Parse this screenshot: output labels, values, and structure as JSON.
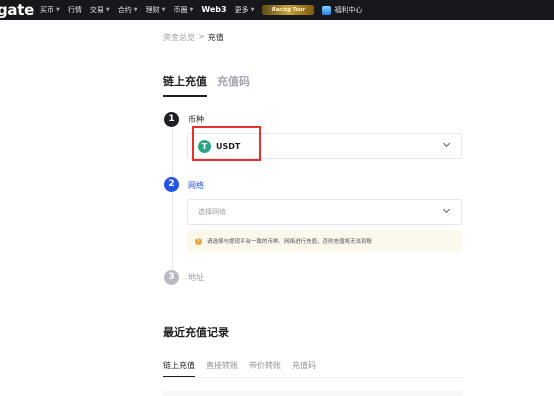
{
  "topnav": {
    "logo": "gate",
    "items": [
      {
        "label": "买币",
        "caret": true
      },
      {
        "label": "行情",
        "caret": false
      },
      {
        "label": "交易",
        "caret": true
      },
      {
        "label": "合约",
        "caret": true
      },
      {
        "label": "理财",
        "caret": true
      },
      {
        "label": "币圈",
        "caret": true
      },
      {
        "label": "Web3",
        "caret": false
      },
      {
        "label": "更多",
        "caret": true
      }
    ],
    "promo_label": "Racing Tour",
    "gift_label": "福利中心"
  },
  "breadcrumb": {
    "parent": "资金总览",
    "separator": ">",
    "current": "充值"
  },
  "tabs": [
    {
      "label": "链上充值",
      "active": true
    },
    {
      "label": "充值码",
      "active": false
    }
  ],
  "steps": {
    "coin": {
      "number": "1",
      "label": "币种",
      "selected_symbol": "T",
      "selected_value": "USDT"
    },
    "network": {
      "number": "2",
      "label": "网络",
      "placeholder": "选择网络"
    },
    "address": {
      "number": "3",
      "label": "地址"
    }
  },
  "notice": {
    "text": "请选择与提现平台一致的币种、网络进行充值，否则充值将无法到账"
  },
  "recent": {
    "title": "最近充值记录",
    "tabs": [
      {
        "label": "链上充值",
        "active": true
      },
      {
        "label": "直接转账",
        "active": false
      },
      {
        "label": "带价转账",
        "active": false
      },
      {
        "label": "充值码",
        "active": false
      }
    ]
  },
  "colors": {
    "nav_bg": "#17181b",
    "step_dark": "#1f2024",
    "step_active": "#2354e6",
    "step_inactive": "#b8bbc2",
    "usdt_green": "#2aa686",
    "highlight_red": "#e5322d",
    "notice_bg": "#fdf8ec",
    "notice_icon": "#f0a32c"
  }
}
